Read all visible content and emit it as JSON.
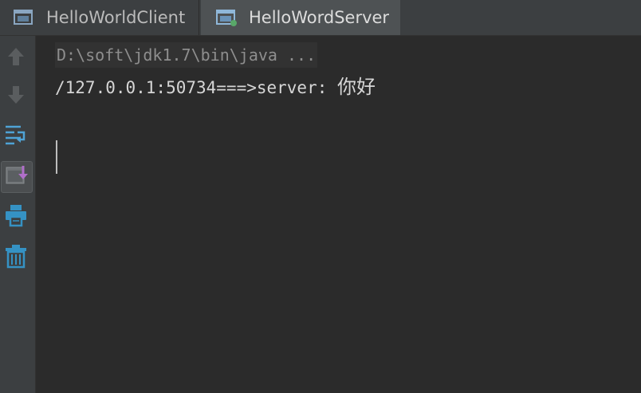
{
  "tabs": [
    {
      "label": "HelloWorldClient",
      "active": false,
      "icon": "console-window-icon"
    },
    {
      "label": "HelloWordServer",
      "active": true,
      "icon": "console-window-running-icon"
    }
  ],
  "toolbar": {
    "buttons": [
      {
        "icon": "arrow-up-icon",
        "enabled": false
      },
      {
        "icon": "arrow-down-icon",
        "enabled": false
      },
      {
        "icon": "soft-wrap-icon",
        "enabled": true
      },
      {
        "icon": "scroll-to-end-icon",
        "enabled": true,
        "selected": true
      },
      {
        "icon": "print-icon",
        "enabled": true
      },
      {
        "icon": "trash-icon",
        "enabled": true
      }
    ]
  },
  "console": {
    "command_line": "D:\\soft\\jdk1.7\\bin\\java ...",
    "output_prefix": "/127.0.0.1:50734===>server: ",
    "output_message": "你好"
  },
  "colors": {
    "background": "#2b2b2b",
    "panel": "#3c3f41",
    "accent_blue": "#3592c4",
    "run_green": "#59a869",
    "scroll_purple": "#b06ec9"
  }
}
